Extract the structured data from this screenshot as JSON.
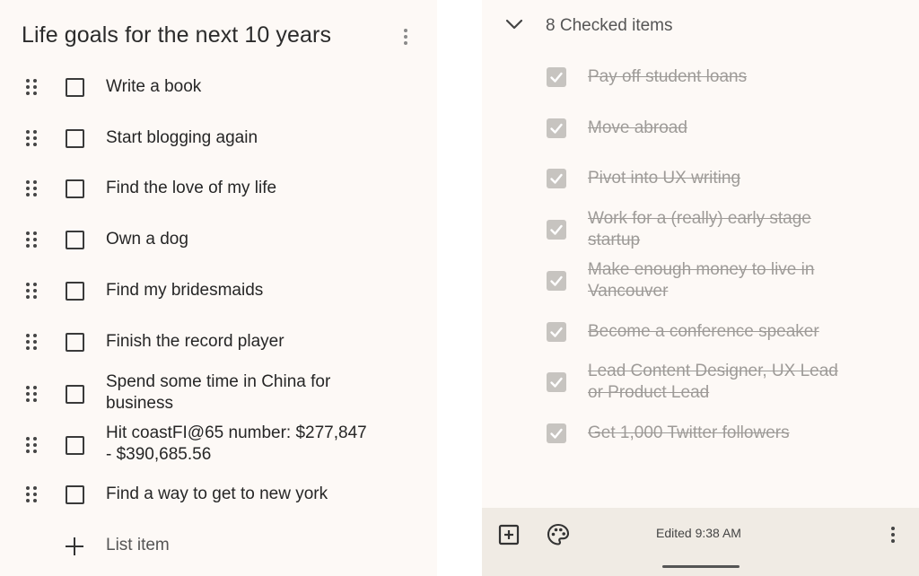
{
  "note": {
    "title": "Life goals for the next 10 years",
    "items": [
      {
        "text": "Write a book"
      },
      {
        "text": "Start blogging again"
      },
      {
        "text": "Find the love of my life"
      },
      {
        "text": "Own a dog"
      },
      {
        "text": "Find my bridesmaids"
      },
      {
        "text": "Finish the record player"
      },
      {
        "text": "Spend some time in China for business"
      },
      {
        "text": "Hit coastFI@65 number: $277,847 - $390,685.56"
      },
      {
        "text": "Find a way to get to new york"
      }
    ],
    "add_item_label": "List item"
  },
  "checked": {
    "header_label": "8 Checked items",
    "items": [
      {
        "text": "Pay off student loans"
      },
      {
        "text": "Move abroad"
      },
      {
        "text": "Pivot into UX writing"
      },
      {
        "text": "Work for a (really) early stage startup"
      },
      {
        "text": "Make enough money to live in Vancouver"
      },
      {
        "text": "Become a conference speaker"
      },
      {
        "text": "Lead Content Designer, UX Lead or Product Lead"
      },
      {
        "text": "Get 1,000 Twitter followers"
      }
    ]
  },
  "bottom_bar": {
    "edited_label": "Edited 9:38 AM"
  },
  "icons": {
    "title_menu": "more-vert-icon",
    "drag": "drag-handle-icon",
    "add": "plus-icon",
    "collapse": "chevron-down-icon",
    "add_box": "add-box-icon",
    "palette": "palette-icon",
    "more": "more-vert-icon"
  },
  "colors": {
    "background": "#fdf9f6",
    "bottom_bar": "#f0ebe4",
    "checked_box": "#c7c4c0",
    "checked_text": "#9e9b98"
  }
}
